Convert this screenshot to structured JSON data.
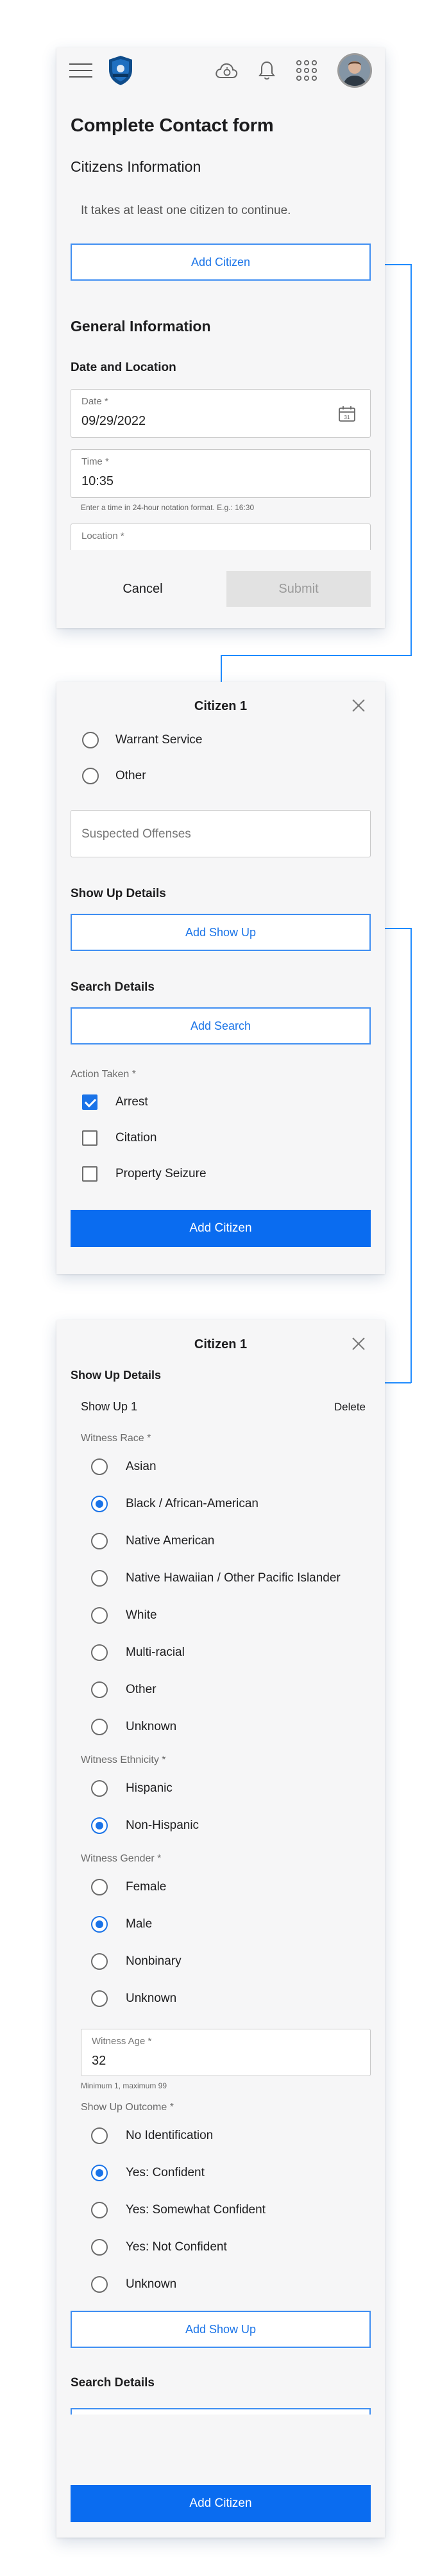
{
  "appbar": {
    "icons": [
      "menu-icon",
      "police-badge-logo",
      "cloud-sync-icon",
      "bell-icon",
      "apps-grid-icon",
      "user-avatar"
    ]
  },
  "form": {
    "title": "Complete Contact form",
    "citizens_heading": "Citizens Information",
    "citizens_helper": "It takes at least one citizen to continue.",
    "add_citizen_label": "Add Citizen",
    "general_heading": "General Information",
    "date_location_heading": "Date and Location",
    "date": {
      "label": "Date *",
      "value": "09/29/2022"
    },
    "time": {
      "label": "Time *",
      "value": "10:35",
      "hint": "Enter a time in 24-hour notation format. E.g.: 16:30"
    },
    "location": {
      "label": "Location *"
    },
    "cancel_label": "Cancel",
    "submit_label": "Submit"
  },
  "citizen_modal": {
    "title": "Citizen 1",
    "reasons": [
      {
        "label": "Warrant Service",
        "selected": false
      },
      {
        "label": "Other",
        "selected": false
      }
    ],
    "offenses_placeholder": "Suspected Offenses",
    "show_up_heading": "Show Up Details",
    "add_show_up_label": "Add Show Up",
    "search_heading": "Search Details",
    "add_search_label": "Add Search",
    "action_taken_label": "Action Taken *",
    "actions": [
      {
        "label": "Arrest",
        "checked": true
      },
      {
        "label": "Citation",
        "checked": false
      },
      {
        "label": "Property Seizure",
        "checked": false
      }
    ],
    "add_citizen_label": "Add Citizen"
  },
  "show_up_modal": {
    "title": "Citizen 1",
    "heading": "Show Up Details",
    "item_title": "Show Up 1",
    "delete_label": "Delete",
    "race_label": "Witness Race *",
    "race_options": [
      {
        "label": "Asian",
        "selected": false
      },
      {
        "label": "Black / African-American",
        "selected": true
      },
      {
        "label": "Native American",
        "selected": false
      },
      {
        "label": "Native Hawaiian / Other Pacific Islander",
        "selected": false
      },
      {
        "label": "White",
        "selected": false
      },
      {
        "label": "Multi-racial",
        "selected": false
      },
      {
        "label": "Other",
        "selected": false
      },
      {
        "label": "Unknown",
        "selected": false
      }
    ],
    "ethnicity_label": "Witness Ethnicity *",
    "ethnicity_options": [
      {
        "label": "Hispanic",
        "selected": false
      },
      {
        "label": "Non-Hispanic",
        "selected": true
      }
    ],
    "gender_label": "Witness Gender *",
    "gender_options": [
      {
        "label": "Female",
        "selected": false
      },
      {
        "label": "Male",
        "selected": true
      },
      {
        "label": "Nonbinary",
        "selected": false
      },
      {
        "label": "Unknown",
        "selected": false
      }
    ],
    "age": {
      "label": "Witness Age *",
      "value": "32",
      "hint": "Minimum 1, maximum 99"
    },
    "outcome_label": "Show Up Outcome *",
    "outcome_options": [
      {
        "label": "No Identification",
        "selected": false
      },
      {
        "label": "Yes: Confident",
        "selected": true
      },
      {
        "label": "Yes: Somewhat Confident",
        "selected": false
      },
      {
        "label": "Yes: Not Confident",
        "selected": false
      },
      {
        "label": "Unknown",
        "selected": false
      }
    ],
    "add_show_up_label": "Add Show Up",
    "search_heading": "Search Details",
    "add_citizen_label": "Add Citizen"
  },
  "colors": {
    "accent": "#1a73e8",
    "primary_button": "#0a6cf0",
    "connector": "#1f8bff",
    "card_background": "#f6f6f7"
  }
}
